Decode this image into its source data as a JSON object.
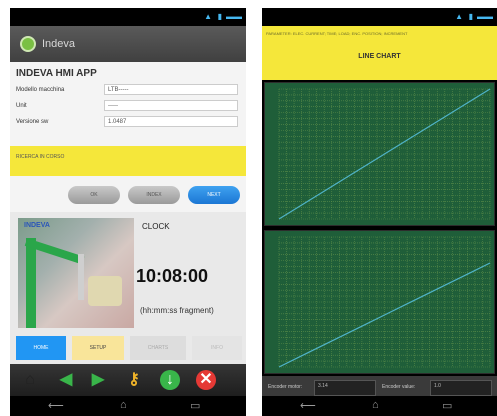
{
  "left": {
    "app_title": "Indeva",
    "inputs_heading": "INDEVA HMI APP",
    "fields": [
      {
        "label": "Modello macchina",
        "value": "LTB-----"
      },
      {
        "label": "Unit",
        "value": "-----"
      },
      {
        "label": "Versione sw",
        "value": "1.0487"
      }
    ],
    "message": "RICERCA IN CORSO",
    "pills": [
      "OK",
      "INDEX",
      "NEXT"
    ],
    "clock_label": "CLOCK",
    "clock_time": "10:08:00",
    "clock_format": "(hh:mm:ss fragment)",
    "photo_brand": "INDEVA",
    "tabs": [
      "HOME",
      "SETUP",
      "CHARTS",
      "INFO"
    ],
    "colors": {
      "yellow": "#f5e73a",
      "blue": "#1e88e5",
      "green_icon": "#39b54a",
      "red_icon": "#e53935",
      "key": "#f0b429"
    }
  },
  "right": {
    "banner_small": "PARAMETER: ELEC. CURRENT; TIME; LOAD; ENC. POSITION; INCREMENT",
    "chart_title": "LINE CHART",
    "bottom_left_label": "Encoder motor:",
    "bottom_left_value": "3.14",
    "bottom_right_label": "Encoder value:",
    "bottom_right_value": "1.0"
  },
  "chart_data": [
    {
      "type": "line",
      "title": "",
      "series": [
        {
          "values": [
            0,
            1,
            2,
            3,
            4,
            5,
            6,
            7,
            8,
            9,
            10
          ]
        }
      ],
      "grid": true
    },
    {
      "type": "line",
      "title": "",
      "series": [
        {
          "values": [
            0,
            0.8,
            1.6,
            2.4,
            3.2,
            4.0,
            4.8,
            5.6,
            6.4,
            7.2,
            8.0
          ]
        }
      ],
      "grid": true
    }
  ]
}
